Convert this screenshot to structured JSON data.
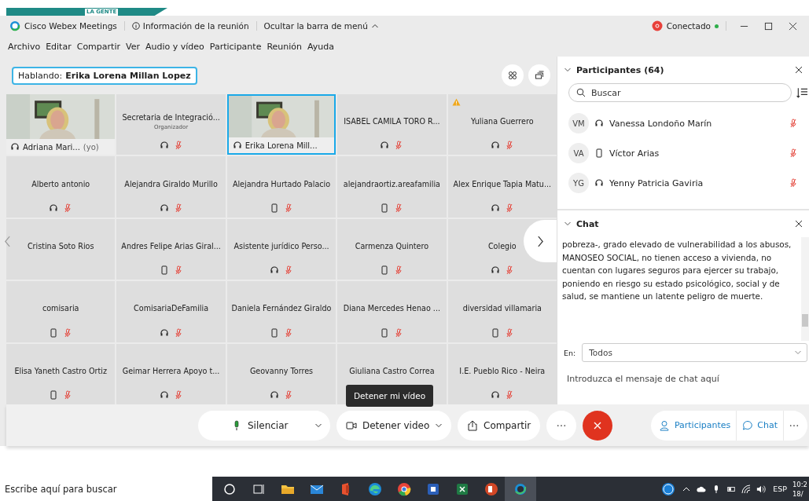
{
  "banner": {
    "text": "LA GENTE"
  },
  "title_bar": {
    "app": "Cisco Webex Meetings",
    "meeting_info": "Información de la reunión",
    "hide_menu": "Ocultar la barra de menú",
    "status": "Conectado"
  },
  "menu": [
    "Archivo",
    "Editar",
    "Compartir",
    "Ver",
    "Audio y vídeo",
    "Participante",
    "Reunión",
    "Ayuda"
  ],
  "speaking": {
    "label": "Hablando:",
    "name": "Erika Lorena Millan Lopez"
  },
  "tiles": [
    {
      "name": "Adriana Mari...",
      "kind": "video",
      "phone": false,
      "speaking": false,
      "warning": false,
      "self_tag": "(yo)"
    },
    {
      "name": "Secretaria de Integració...",
      "kind": "avatar",
      "phone": false,
      "muted": true,
      "speaking": false,
      "warning": false,
      "role": "Organizador"
    },
    {
      "name": "Erika Lorena Mill...",
      "kind": "video",
      "phone": false,
      "speaking": true,
      "warning": false
    },
    {
      "name": "ISABEL CAMILA TORO R...",
      "kind": "avatar",
      "phone": false,
      "muted": true,
      "speaking": false,
      "warning": false
    },
    {
      "name": "Yuliana Guerrero",
      "kind": "avatar",
      "phone": false,
      "muted": true,
      "speaking": false,
      "warning": true
    },
    {
      "name": "Alberto antonio",
      "kind": "avatar",
      "phone": false,
      "muted": true,
      "speaking": false,
      "warning": false
    },
    {
      "name": "Alejandra Giraldo Murillo",
      "kind": "avatar",
      "phone": false,
      "muted": true,
      "speaking": false,
      "warning": false
    },
    {
      "name": "Alejandra Hurtado Palacio",
      "kind": "avatar",
      "phone": true,
      "muted": true,
      "speaking": false,
      "warning": false
    },
    {
      "name": "alejandraortiz.areafamilia",
      "kind": "avatar",
      "phone": true,
      "muted": true,
      "speaking": false,
      "warning": false
    },
    {
      "name": "Alex Enrique Tapia Matu...",
      "kind": "avatar",
      "phone": false,
      "muted": true,
      "speaking": false,
      "warning": false
    },
    {
      "name": "Cristina Soto Rios",
      "kind": "avatar",
      "speaking": false,
      "warning": false
    },
    {
      "name": "Andres Felipe Arias Giral...",
      "kind": "avatar",
      "phone": true,
      "muted": true,
      "speaking": false,
      "warning": false
    },
    {
      "name": "Asistente jurídico Perso...",
      "kind": "avatar",
      "phone": false,
      "muted": true,
      "speaking": false,
      "warning": false
    },
    {
      "name": "Carmenza Quintero",
      "kind": "avatar",
      "phone": true,
      "muted": true,
      "speaking": false,
      "warning": false
    },
    {
      "name": "Colegio",
      "kind": "avatar",
      "phone": false,
      "muted": true,
      "speaking": false,
      "warning": false
    },
    {
      "name": "comisaria",
      "kind": "avatar",
      "phone": true,
      "muted": true,
      "speaking": false,
      "warning": false
    },
    {
      "name": "ComisariaDeFamilia",
      "kind": "avatar",
      "phone": false,
      "muted": true,
      "speaking": false,
      "warning": false
    },
    {
      "name": "Daniela Fernández Giraldo",
      "kind": "avatar",
      "phone": true,
      "muted": true,
      "speaking": false,
      "warning": false
    },
    {
      "name": "Diana Mercedes Henao ...",
      "kind": "avatar",
      "phone": true,
      "muted": true,
      "speaking": false,
      "warning": false
    },
    {
      "name": "diversidad villamaria",
      "kind": "avatar",
      "phone": true,
      "muted": true,
      "speaking": false,
      "warning": false
    },
    {
      "name": "Elisa Yaneth Castro Ortiz",
      "kind": "avatar",
      "phone": true,
      "muted": true,
      "speaking": false,
      "warning": false
    },
    {
      "name": "Geimar Herrera Apoyo t...",
      "kind": "avatar",
      "phone": false,
      "muted": true,
      "speaking": false,
      "warning": false
    },
    {
      "name": "Geovanny Torres",
      "kind": "avatar",
      "phone": false,
      "muted": true,
      "speaking": false,
      "warning": false
    },
    {
      "name": "Giuliana Castro Correa",
      "kind": "avatar",
      "speaking": false,
      "warning": false
    },
    {
      "name": "I.E. Pueblo Rico - Neira",
      "kind": "avatar",
      "phone": false,
      "muted": true,
      "speaking": false,
      "warning": false
    }
  ],
  "tooltip": {
    "text": "Detener mi vídeo"
  },
  "controls": {
    "mute": "Silenciar",
    "video": "Detener video",
    "share": "Compartir",
    "participants": "Participantes",
    "chat": "Chat"
  },
  "participants": {
    "title": "Participantes (64)",
    "search_placeholder": "Buscar",
    "items": [
      {
        "initials": "VM",
        "phone": false,
        "name": "Vanessa Londoño Marín",
        "muted": true
      },
      {
        "initials": "VA",
        "phone": true,
        "name": "Víctor Arias",
        "muted": true
      },
      {
        "initials": "YG",
        "phone": false,
        "name": "Yenny Patricia Gaviria",
        "muted": true
      }
    ]
  },
  "chat": {
    "title": "Chat",
    "message": "pobreza-, grado elevado de vulnerabilidad a los abusos, MANOSEO SOCIAL, no  tienen acceso  a vivienda, no cuentan  con lugares seguros para ejercer su trabajo, poniendo  en riesgo su estado psicológico, social y  de salud,  se mantiene un latente peligro de muerte.",
    "to_label": "En:",
    "to_value": "Todos",
    "input_placeholder": "Introduzca el mensaje de chat aquí"
  },
  "taskbar": {
    "search_placeholder": "Escribe aquí para buscar",
    "language": "ESP",
    "time": "10:2",
    "date": "18/"
  }
}
